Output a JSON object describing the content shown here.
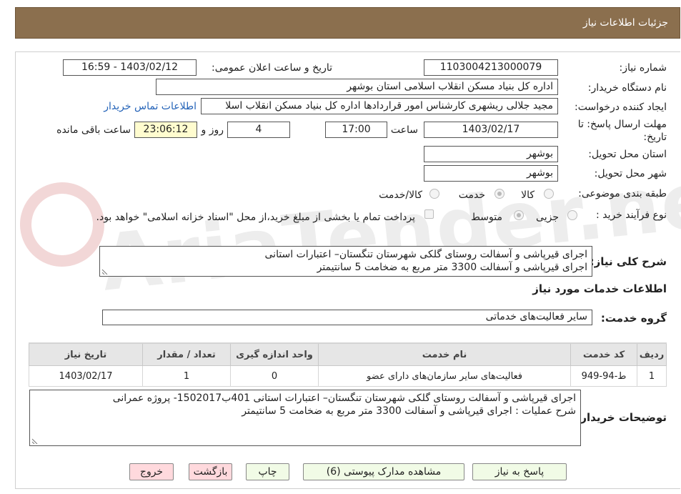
{
  "header": {
    "title": "جزئیات اطلاعات نیاز"
  },
  "fields": {
    "need_number_label": "شماره نیاز:",
    "need_number": "1103004213000079",
    "announce_label": "تاریخ و ساعت اعلان عمومی:",
    "announce_value": "1403/02/12 - 16:59",
    "buyer_label": "نام دستگاه خریدار:",
    "buyer": "اداره کل بنیاد مسکن انقلاب اسلامی استان بوشهر",
    "creator_label": "ایجاد کننده درخواست:",
    "creator": "مجید جلالی ریشهری کارشناس امور قراردادها اداره کل بنیاد مسکن انقلاب اسلا",
    "contact_link": "اطلاعات تماس خریدار",
    "deadline_label": "مهلت ارسال پاسخ: تا تاریخ:",
    "deadline_date": "1403/02/17",
    "time_label": "ساعت",
    "deadline_time": "17:00",
    "days": "4",
    "days_label": "روز و",
    "remaining": "23:06:12",
    "remaining_label": "ساعت باقی مانده",
    "province_label": "استان محل تحویل:",
    "province": "بوشهر",
    "city_label": "شهر محل تحویل:",
    "city": "بوشهر",
    "category_label": "طبقه بندی موضوعی:",
    "category_options": [
      "کالا",
      "خدمت",
      "کالا/خدمت"
    ],
    "process_label": "نوع فرآیند خرید :",
    "process_options": [
      "جزیی",
      "متوسط"
    ],
    "payment_note": "پرداخت تمام یا بخشی از مبلغ خرید،از محل \"اسناد خزانه اسلامی\" خواهد بود."
  },
  "summary": {
    "label": "شرح کلی نیاز:",
    "line1": "اجرای قیرپاشی و آسفالت روستای گلکی شهرستان تنگستان– اعتبارات استانی",
    "line2": "اجرای قیرپاشی و آسفالت 3300 متر مربع به ضخامت 5 سانتیمتر"
  },
  "services": {
    "section_title": "اطلاعات خدمات مورد نیاز",
    "group_label": "گروه خدمت:",
    "group_value": "سایر فعالیت‌های خدماتی",
    "columns": [
      "ردیف",
      "کد خدمت",
      "نام خدمت",
      "واحد اندازه گیری",
      "تعداد / مقدار",
      "تاریخ نیاز"
    ],
    "rows": [
      [
        "1",
        "ط-94-949",
        "فعالیت‌های سایر سازمان‌های دارای عضو",
        "0",
        "1",
        "1403/02/17"
      ]
    ]
  },
  "buyer_notes": {
    "label": "توضیحات خریدار:",
    "line1": "اجرای قیرپاشی و آسفالت روستای گلکی شهرستان تنگستان– اعتبارات استانی 401ب1502017- پروژه عمرانی",
    "line2": "شرح عملیات : اجرای قیرپاشی و آسفالت 3300 متر مربع به ضخامت 5 سانتیمتر"
  },
  "buttons": {
    "reply": "پاسخ به نیاز",
    "attachments": "مشاهده مدارک پیوستی (6)",
    "print": "چاپ",
    "back": "بازگشت",
    "exit": "خروج"
  },
  "watermark": {
    "text": "AriaTender.neT"
  },
  "colors": {
    "header_bg": "#8b6f4e",
    "link": "#2463b8",
    "remaining_bg": "#fffccf",
    "button_green": "#f1fbe6",
    "button_pink": "#ffd9dd"
  },
  "icons": {
    "resize_grip": "resize-grip-icon",
    "radio": "radio-icon",
    "checkbox": "checkbox-icon"
  }
}
